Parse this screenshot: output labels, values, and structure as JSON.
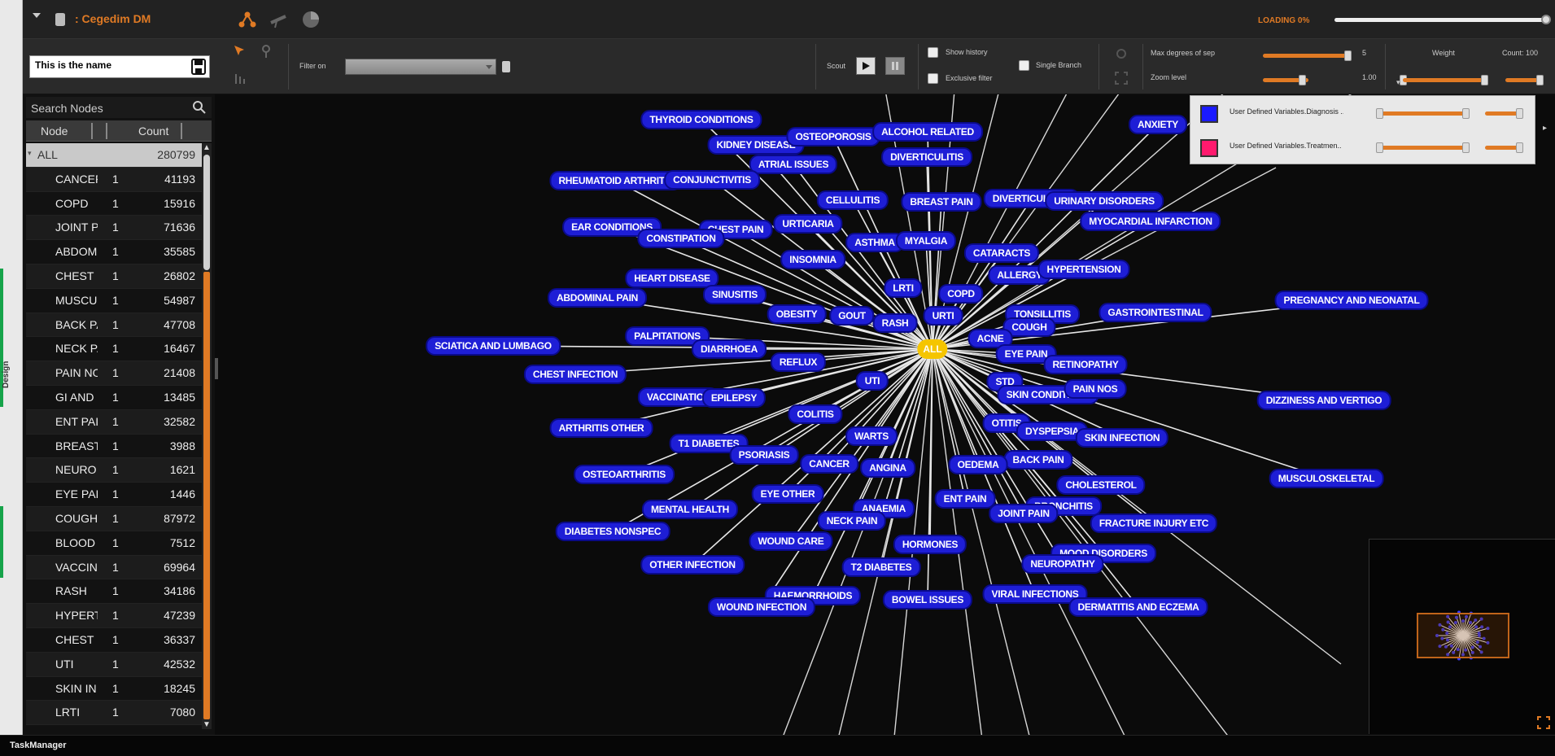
{
  "app": {
    "title": ": Cegedim DM",
    "loading": "LOADING 0%"
  },
  "toolbar": {
    "name_value": "This is the name",
    "filter_on": "Filter on",
    "scout": "Scout",
    "show_history": "Show history",
    "exclusive_filter": "Exclusive filter",
    "single_branch": "Single Branch",
    "max_degrees_label": "Max degrees of sep",
    "max_degrees_value": "5",
    "zoom_label": "Zoom level",
    "zoom_value": "1.00",
    "weight_label": "Weight",
    "count_label": "Count: 100"
  },
  "legend": [
    {
      "label": "User Defined Variables.Diagnosis ..",
      "color": "#1a1aff"
    },
    {
      "label": "User Defined Variables.Treatmen..",
      "color": "#ff1a6e"
    }
  ],
  "panel": {
    "search_placeholder": "Search Nodes",
    "col_node": "Node",
    "col_count": "Count",
    "rows": [
      {
        "node": "ALL",
        "one": "",
        "count": "280799"
      },
      {
        "node": "CANCER",
        "one": "1",
        "count": "41193"
      },
      {
        "node": "COPD",
        "one": "1",
        "count": "15916"
      },
      {
        "node": "JOINT PAIN",
        "one": "1",
        "count": "71636"
      },
      {
        "node": "ABDOMINAL",
        "one": "1",
        "count": "35585"
      },
      {
        "node": "CHEST",
        "one": "1",
        "count": "26802"
      },
      {
        "node": "MUSCULO",
        "one": "1",
        "count": "54987"
      },
      {
        "node": "BACK PAIN",
        "one": "1",
        "count": "47708"
      },
      {
        "node": "NECK PAIN",
        "one": "1",
        "count": "16467"
      },
      {
        "node": "PAIN NOS",
        "one": "1",
        "count": "21408"
      },
      {
        "node": "GI AND",
        "one": "1",
        "count": "13485"
      },
      {
        "node": "ENT PAIN",
        "one": "1",
        "count": "32582"
      },
      {
        "node": "BREAST",
        "one": "1",
        "count": "3988"
      },
      {
        "node": "NEURO",
        "one": "1",
        "count": "1621"
      },
      {
        "node": "EYE PAIN",
        "one": "1",
        "count": "1446"
      },
      {
        "node": "COUGH",
        "one": "1",
        "count": "87972"
      },
      {
        "node": "BLOOD",
        "one": "1",
        "count": "7512"
      },
      {
        "node": "VACCIN",
        "one": "1",
        "count": "69964"
      },
      {
        "node": "RASH",
        "one": "1",
        "count": "34186"
      },
      {
        "node": "HYPERT",
        "one": "1",
        "count": "47239"
      },
      {
        "node": "CHEST",
        "one": "1",
        "count": "36337"
      },
      {
        "node": "UTI",
        "one": "1",
        "count": "42532"
      },
      {
        "node": "SKIN IN",
        "one": "1",
        "count": "18245"
      },
      {
        "node": "LRTI",
        "one": "1",
        "count": "7080"
      }
    ]
  },
  "graph": {
    "root": "ALL",
    "nodes": [
      "THYROID CONDITIONS",
      "KIDNEY DISEASE",
      "OSTEOPOROSIS",
      "ALCOHOL RELATED",
      "ANXIETY",
      "ATRIAL ISSUES",
      "DIVERTICULITIS",
      "RHEUMATOID ARTHRITIS",
      "CONJUNCTIVITIS",
      "CELLULITIS",
      "BREAST PAIN",
      "DIVERTICULOSIS",
      "URINARY DISORDERS",
      "EAR CONDITIONS",
      "CHEST PAIN",
      "URTICARIA",
      "CONSTIPATION",
      "ASTHMA",
      "MYALGIA",
      "MYOCARDIAL INFARCTION",
      "INSOMNIA",
      "CATARACTS",
      "HEART DISEASE",
      "ALLERGY",
      "HYPERTENSION",
      "SINUSITIS",
      "LRTI",
      "COPD",
      "ABDOMINAL PAIN",
      "URTI",
      "PREGNANCY AND NEONATAL",
      "GASTROINTESTINAL",
      "OBESITY",
      "GOUT",
      "RASH",
      "TONSILLITIS",
      "COUGH",
      "PALPITATIONS",
      "ACNE",
      "SCIATICA AND LUMBAGO",
      "DIARRHOEA",
      "EYE PAIN",
      "REFLUX",
      "RETINOPATHY",
      "CHEST INFECTION",
      "UTI",
      "STD",
      "SKIN CONDITIONS",
      "PAIN NOS",
      "VACCINATION",
      "EPILEPSY",
      "DIZZINESS AND VERTIGO",
      "COLITIS",
      "OTITIS",
      "ARTHRITIS OTHER",
      "DYSPEPSIA",
      "SKIN INFECTION",
      "WARTS",
      "T1 DIABETES",
      "PSORIASIS",
      "BACK PAIN",
      "CANCER",
      "ANGINA",
      "OEDEMA",
      "MUSCULOSKELETAL",
      "OSTEOARTHRITIS",
      "CHOLESTEROL",
      "EYE OTHER",
      "ENT PAIN",
      "BRONCHITIS",
      "MENTAL HEALTH",
      "ANAEMIA",
      "JOINT PAIN",
      "NECK PAIN",
      "FRACTURE INJURY ETC",
      "DIABETES NONSPEC",
      "WOUND CARE",
      "HORMONES",
      "MOOD DISORDERS",
      "NEUROPATHY",
      "OTHER INFECTION",
      "T2 DIABETES",
      "HAEMORRHOIDS",
      "VIRAL INFECTIONS",
      "BOWEL ISSUES",
      "WOUND INFECTION",
      "DERMATITIS AND ECZEMA"
    ]
  },
  "taskbar": {
    "label": "TaskManager"
  }
}
